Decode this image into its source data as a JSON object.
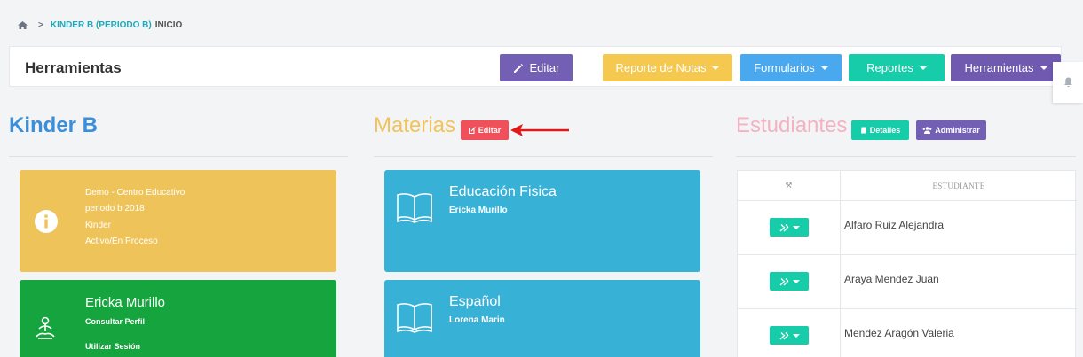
{
  "breadcrumb": {
    "link": "KINDER B (PERIODO B)",
    "current": "INICIO"
  },
  "toolbar": {
    "title": "Herramientas",
    "buttons": {
      "editar": "Editar",
      "notas": "Reporte de Notas",
      "formularios": "Formularios",
      "reportes": "Reportes",
      "herramientas": "Herramientas"
    }
  },
  "kinder": {
    "title": "Kinder B",
    "info": [
      "Demo - Centro Educativo",
      "periodo b 2018",
      "Kinder",
      "Activo/En Proceso"
    ],
    "user": {
      "name": "Ericka Murillo",
      "profile": "Consultar Perfil",
      "session": "Utilizar Sesión"
    }
  },
  "materias": {
    "title": "Materias",
    "edit_label": "Editar",
    "subjects": [
      {
        "name": "Educación Fisica",
        "teacher": "Ericka Murillo"
      },
      {
        "name": "Español",
        "teacher": "Lorena Marin"
      }
    ]
  },
  "estudiantes": {
    "title": "Estudiantes",
    "details_label": "Detalles",
    "admin_label": "Administrar",
    "header_tools": "⚒",
    "header_name": "ESTUDIANTE",
    "rows": [
      "Alfaro Ruiz Alejandra",
      "Araya Mendez Juan",
      "Mendez Aragón Valeria"
    ]
  },
  "colors": {
    "accent_blue": "#3b8fd9",
    "teal": "#17cca8",
    "purple": "#7360b5",
    "yellow": "#f5c94f",
    "red": "#f0505a",
    "green": "#15a43e",
    "subject_blue": "#38b1d7"
  }
}
